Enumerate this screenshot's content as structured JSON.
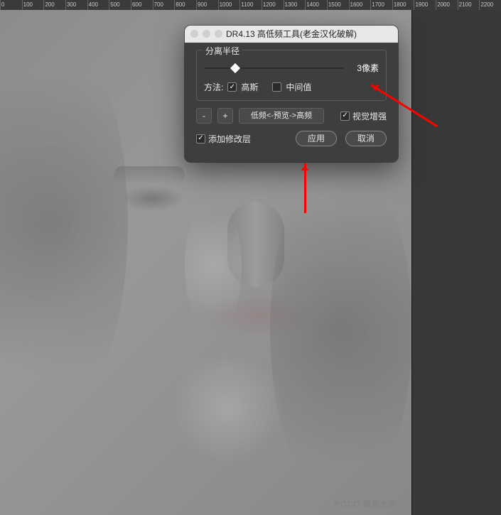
{
  "ruler": {
    "ticks": [
      "0",
      "100",
      "200",
      "300",
      "400",
      "500",
      "600",
      "700",
      "800",
      "900",
      "1000",
      "1100",
      "1200",
      "1300",
      "1400",
      "1500",
      "1600",
      "1700",
      "1800",
      "1900",
      "2000",
      "2100",
      "2200"
    ]
  },
  "watermark": "POCO 摄影专区",
  "dialog": {
    "title": "DR4.13 高低频工具(老金汉化破解)",
    "radius_label": "分离半径",
    "radius_value": "3像素",
    "slider_percent": 20,
    "method_label": "方法:",
    "gaussian": {
      "label": "高斯",
      "checked": true
    },
    "median": {
      "label": "中间值",
      "checked": false
    },
    "minus": "-",
    "plus": "+",
    "preview_label": "低频<-预览->高频",
    "visual_enhance": {
      "label": "视觉增强",
      "checked": true
    },
    "add_layer": {
      "label": "添加修改层",
      "checked": true
    },
    "apply": "应用",
    "cancel": "取消"
  }
}
